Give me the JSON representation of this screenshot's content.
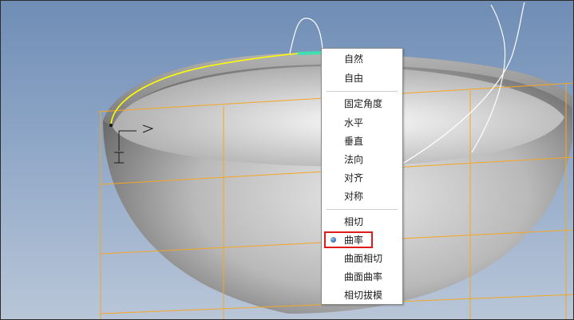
{
  "menu": {
    "group1": [
      "自然",
      "自由"
    ],
    "group2": [
      "固定角度",
      "水平",
      "垂直",
      "法向",
      "对齐",
      "对称"
    ],
    "group3": [
      "相切",
      "曲率",
      "曲面相切",
      "曲面曲率",
      "相切拔模"
    ],
    "selected": "曲率"
  },
  "colors": {
    "highlight": "#e01b1b",
    "edge": "#f5a623",
    "curve": "#ffff00",
    "selection": "#3fe0b0",
    "background": "#7f9bc0"
  }
}
